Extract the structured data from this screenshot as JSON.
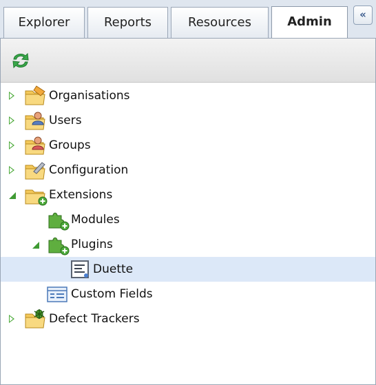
{
  "tabs": {
    "explorer": "Explorer",
    "reports": "Reports",
    "resources": "Resources",
    "admin": "Admin",
    "collapse": "«"
  },
  "toolbar": {
    "refresh_icon": "refresh-icon"
  },
  "tree": {
    "organisations": "Organisations",
    "users": "Users",
    "groups": "Groups",
    "configuration": "Configuration",
    "extensions": "Extensions",
    "modules": "Modules",
    "plugins": "Plugins",
    "duette": "Duette",
    "custom_fields": "Custom Fields",
    "defect_trackers": "Defect Trackers"
  },
  "colors": {
    "selected_row": "#dce8f8",
    "tab_strip": "#dfe6ef",
    "tree_arrow": "#4caa3a"
  }
}
